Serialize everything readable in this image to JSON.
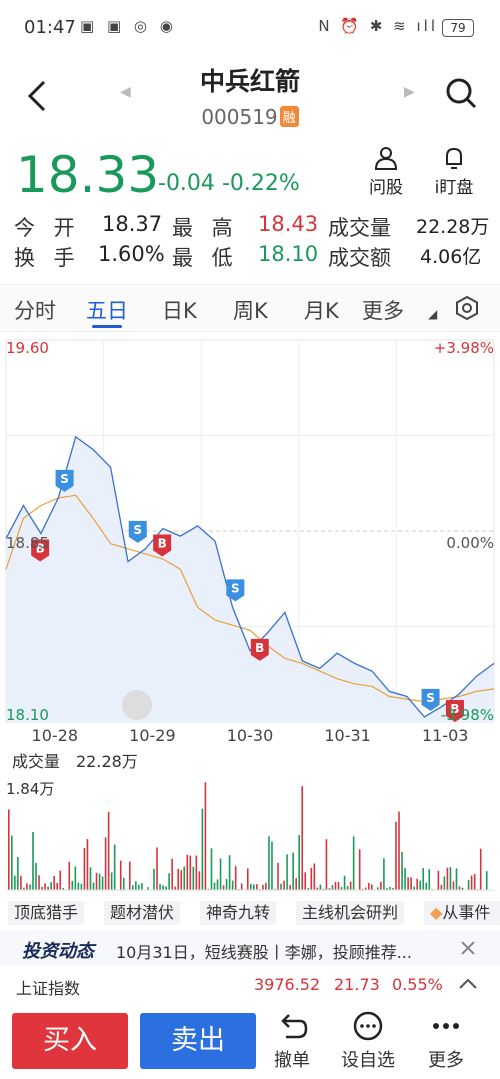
{
  "status_bar": {
    "time": "01:47",
    "left_icons": "▣ ▣ ◎ ◉",
    "right_icons": "N ⏰ ✱ ≋ ıll",
    "battery": "79"
  },
  "header": {
    "title": "中兵红箭",
    "code": "000519",
    "badge": "融",
    "back_icon": "chevron-left-icon",
    "search_icon": "search-icon"
  },
  "quote": {
    "price": "18.33",
    "change": "-0.04",
    "change_pct": "-0.22%",
    "actions": [
      {
        "label": "问股",
        "icon": "person-icon"
      },
      {
        "label": "i盯盘",
        "icon": "bell-icon"
      }
    ]
  },
  "stats": {
    "open_label": "今 开",
    "open": "18.37",
    "high_label": "最 高",
    "high": "18.43",
    "volume_label": "成交量",
    "volume": "22.28万",
    "turnover_label": "换 手",
    "turnover": "1.60%",
    "low_label": "最 低",
    "low": "18.10",
    "amount_label": "成交额",
    "amount": "4.06亿"
  },
  "tabs": [
    "分时",
    "五日",
    "日K",
    "周K",
    "月K",
    "更多"
  ],
  "active_tab": "五日",
  "chart_labels": {
    "top_price": "19.60",
    "top_pct": "+3.98%",
    "mid_price": "18.85",
    "mid_pct": "0.00%",
    "bottom_price": "18.10",
    "bottom_pct": "-3.98%",
    "volume_label": "成交量",
    "volume_value": "22.28万",
    "volume_max": "1.84万"
  },
  "chart_data": {
    "type": "line",
    "x_labels": [
      "10-28",
      "10-29",
      "10-30",
      "10-31",
      "11-03"
    ],
    "ylim": [
      18.1,
      19.6
    ],
    "series": [
      {
        "values": [
          18.82,
          18.95,
          18.84,
          18.98,
          19.22,
          19.17,
          19.1,
          18.73,
          18.78,
          18.86,
          18.83,
          18.87,
          18.81,
          18.55,
          18.38,
          18.45,
          18.53,
          18.34,
          18.31,
          18.37,
          18.33,
          18.3,
          18.22,
          18.2,
          18.12,
          18.16,
          18.21,
          18.28,
          18.33
        ]
      },
      {
        "values": [
          18.7,
          18.9,
          18.95,
          18.98,
          18.99,
          18.9,
          18.8,
          18.78,
          18.76,
          18.74,
          18.7,
          18.55,
          18.5,
          18.48,
          18.46,
          18.4,
          18.35,
          18.33,
          18.3,
          18.27,
          18.25,
          18.24,
          18.2,
          18.19,
          18.18,
          18.19,
          18.2,
          18.22,
          18.23
        ]
      }
    ],
    "markers": [
      {
        "type": "S",
        "day": "10-28"
      },
      {
        "type": "B",
        "day": "10-28"
      },
      {
        "type": "B",
        "day": "10-29"
      },
      {
        "type": "S",
        "day": "10-29"
      },
      {
        "type": "B",
        "day": "10-30"
      },
      {
        "type": "S",
        "day": "10-30"
      },
      {
        "type": "B",
        "day": "11-03"
      },
      {
        "type": "S",
        "day": "11-03"
      }
    ],
    "volume_ylim": [
      0,
      1.84
    ]
  },
  "topics": [
    "顶底猎手",
    "题材潜伏",
    "神奇九转",
    "主线机会研判",
    "从事件"
  ],
  "news": {
    "brand": "投资动态",
    "text": "10月31日，短线赛股丨李娜，投顾推荐..."
  },
  "index_row": {
    "name": "上证指数",
    "value": "3976.52",
    "change": "21.73",
    "pct": "0.55%"
  },
  "actions": {
    "buy": "买入",
    "sell": "卖出",
    "items": [
      {
        "label": "撤单",
        "icon": "undo-icon"
      },
      {
        "label": "设自选",
        "icon": "dots-circle-icon"
      },
      {
        "label": "更多",
        "icon": "more-icon"
      }
    ]
  },
  "colors": {
    "up": "#d6343c",
    "down": "#1a9a5a",
    "accent": "#1f5ed8",
    "buy": "#e0353d",
    "sell": "#2b6fe0"
  }
}
